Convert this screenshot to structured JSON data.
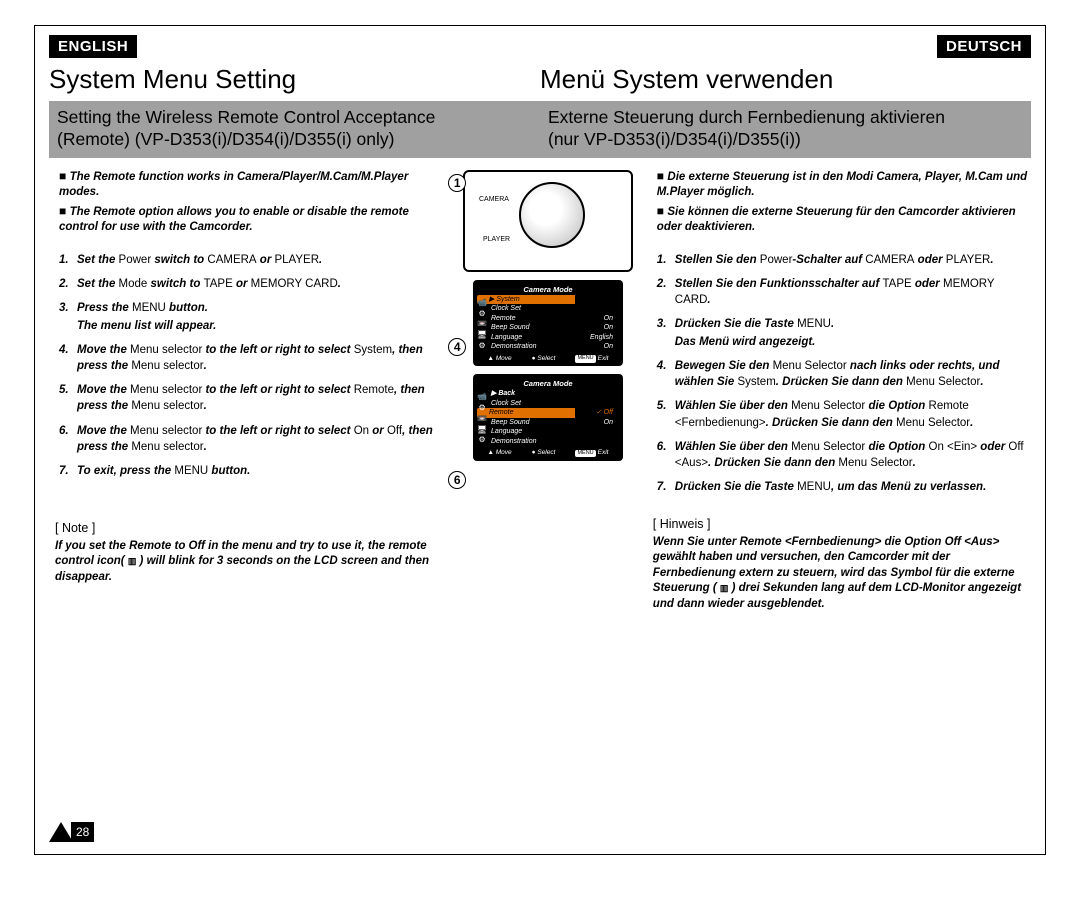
{
  "lang": {
    "en": "ENGLISH",
    "de": "DEUTSCH"
  },
  "title": {
    "en": "System Menu Setting",
    "de": "Menü System verwenden"
  },
  "subtitle": {
    "en_l1": "Setting the Wireless Remote Control Acceptance",
    "en_l2": "(Remote) (VP-D353(i)/D354(i)/D355(i) only)",
    "de_l1": "Externe Steuerung durch Fernbedienung aktivieren",
    "de_l2": "(nur VP-D353(i)/D354(i)/D355(i))"
  },
  "intro_en": [
    "The Remote function works in Camera/Player/M.Cam/M.Player modes.",
    "The Remote option allows you to enable or disable the remote control for use with the Camcorder."
  ],
  "intro_de": [
    "Die externe Steuerung ist in den Modi Camera, Player, M.Cam und M.Player möglich.",
    "Sie können die externe Steuerung für den Camcorder aktivieren oder deaktivieren."
  ],
  "steps_en": [
    {
      "n": "1.",
      "html": "Set the <span class='rom'>Power</span> switch to <span class='rom'>CAMERA</span> or <span class='rom'>PLAYER</span>."
    },
    {
      "n": "2.",
      "html": "Set the <span class='rom'>Mode</span> switch to <span class='rom'>TAPE</span> or <span class='rom'>MEMORY CARD</span>."
    },
    {
      "n": "3.",
      "html": "Press the <span class='rom'>MENU</span> button.<span class='sub-indent'>The menu list will appear.</span>"
    },
    {
      "n": "4.",
      "html": "Move the <span class='rom'>Menu selector</span> to the left or right to select <span class='rom'>System</span>, then press the <span class='rom'>Menu selector</span>."
    },
    {
      "n": "5.",
      "html": "Move the <span class='rom'>Menu selector</span> to the left or right to select <span class='rom'>Remote</span>, then press the <span class='rom'>Menu selector</span>."
    },
    {
      "n": "6.",
      "html": "Move the <span class='rom'>Menu selector</span> to the left or right to select <span class='rom'>On</span> or <span class='rom'>Off</span>, then press the <span class='rom'>Menu selector</span>."
    },
    {
      "n": "7.",
      "html": "To exit, press the <span class='rom'>MENU</span> button."
    }
  ],
  "steps_de": [
    {
      "n": "1.",
      "html": "Stellen Sie den <span class='rom'>Power</span>-Schalter auf <span class='rom'>CAMERA</span> oder <span class='rom'>PLAYER</span>."
    },
    {
      "n": "2.",
      "html": "Stellen Sie den Funktionsschalter auf <span class='rom'>TAPE</span> oder <span class='rom'>MEMORY CARD</span>."
    },
    {
      "n": "3.",
      "html": "Drücken Sie die Taste <span class='rom'>MENU</span>.<span class='sub-indent'>Das Menü wird angezeigt.</span>"
    },
    {
      "n": "4.",
      "html": "Bewegen Sie den <span class='rom'>Menu Selector</span> nach links oder rechts, und wählen Sie <span class='rom'>System</span>. Drücken Sie dann den <span class='rom'>Menu Selector</span>."
    },
    {
      "n": "5.",
      "html": "Wählen Sie über den <span class='rom'>Menu Selector</span> die Option <span class='rom'>Remote &lt;Fernbedienung&gt;</span>. Drücken Sie dann den <span class='rom'>Menu Selector</span>."
    },
    {
      "n": "6.",
      "html": "Wählen Sie über den <span class='rom'>Menu Selector</span> die Option <span class='rom'>On &lt;Ein&gt;</span> oder <span class='rom'>Off &lt;Aus&gt;</span>. Drücken Sie dann den <span class='rom'>Menu Selector</span>."
    },
    {
      "n": "7.",
      "html": "Drücken Sie die Taste <span class='rom'>MENU</span>, um das Menü zu verlassen."
    }
  ],
  "note_label": {
    "en": "[ Note ]",
    "de": "[ Hinweis ]"
  },
  "note_en": "If you set the Remote to Off in the menu and try to use it, the remote control icon( <span class='icon-sym'>▥</span> ) will blink for 3 seconds on the LCD screen and then disappear.",
  "note_de": "Wenn Sie unter Remote &lt;Fernbedienung&gt; die Option Off &lt;Aus&gt; gewählt haben und versuchen, den Camcorder mit der Fernbedienung extern zu steuern, wird das Symbol für die externe Steuerung ( <span class='icon-sym'>▥</span> ) drei Sekunden lang auf dem LCD-Monitor angezeigt und dann wieder ausgeblendet.",
  "step_circles": {
    "s1": "1",
    "s4": "4",
    "s6": "6"
  },
  "dial": {
    "camera": "CAMERA",
    "player": "PLAYER"
  },
  "menu4": {
    "header": "Camera Mode",
    "system_row": "System",
    "items": [
      {
        "k": "Clock Set",
        "v": ""
      },
      {
        "k": "Remote",
        "v": "On"
      },
      {
        "k": "Beep Sound",
        "v": "On"
      },
      {
        "k": "Language",
        "v": "English"
      },
      {
        "k": "Demonstration",
        "v": "On"
      }
    ],
    "move": "Move",
    "select": "Select",
    "exit": "Exit",
    "menu": "MENU"
  },
  "menu6": {
    "header": "Camera Mode",
    "back_row": "Back",
    "items": [
      {
        "k": "Clock Set",
        "v": ""
      },
      {
        "k": "Remote",
        "v": "Off",
        "selected": true,
        "vsel": true
      },
      {
        "k": "Beep Sound",
        "v": "On"
      },
      {
        "k": "Language",
        "v": ""
      },
      {
        "k": "Demonstration",
        "v": ""
      }
    ],
    "move": "Move",
    "select": "Select",
    "exit": "Exit",
    "menu": "MENU"
  },
  "page_number": "28"
}
